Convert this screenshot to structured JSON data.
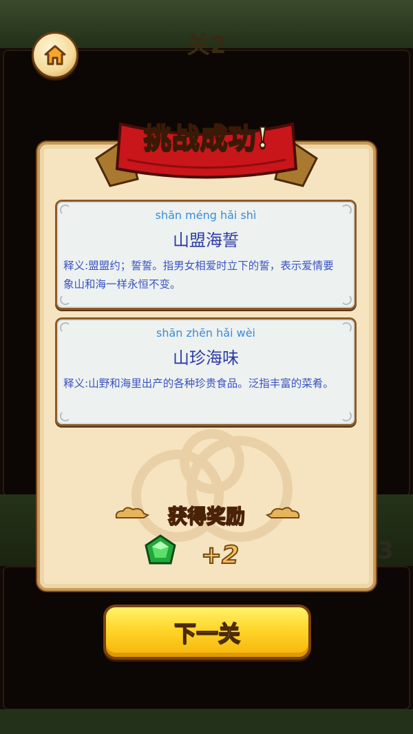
{
  "background": {
    "level_text": "关2",
    "side_number": "3"
  },
  "home_button": {
    "icon": "home-icon"
  },
  "dialog": {
    "title": "挑战成功!",
    "cards": [
      {
        "pinyin": "shān méng hǎi shì",
        "idiom": "山盟海誓",
        "explanation": "释义:盟盟约；誓誓。指男女相爱时立下的誓，表示爱情要象山和海一样永恒不变。"
      },
      {
        "pinyin": "shān zhēn hǎi wèi",
        "idiom": "山珍海味",
        "explanation": "释义:山野和海里出产的各种珍贵食品。泛指丰富的菜肴。"
      }
    ],
    "reward": {
      "title": "获得奖励",
      "icon": "gem-icon",
      "amount": "+2"
    },
    "next_button": "下一关"
  },
  "colors": {
    "panel": "#f6e4c0",
    "ribbon": "#c8161a",
    "idiom_text": "#2c3aa6",
    "pinyin_text": "#3a8ad8",
    "button": "#ffd52a"
  }
}
